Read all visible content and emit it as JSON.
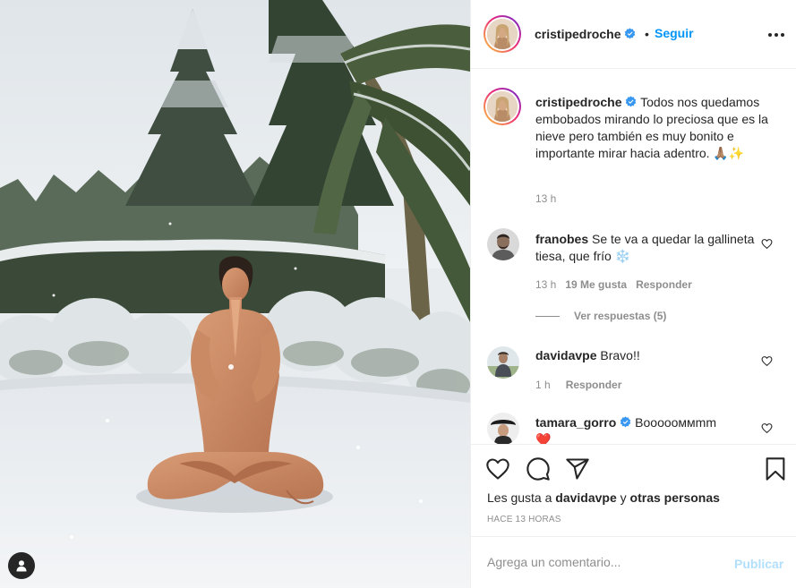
{
  "photo": {
    "alt_icon": "user-tag-icon"
  },
  "header": {
    "username": "cristipedroche",
    "verified": true,
    "separator": "•",
    "follow_label": "Seguir",
    "more_icon": "more-options-icon"
  },
  "caption": {
    "username": "cristipedroche",
    "text": "Todos nos quedamos embobados mirando lo preciosa que es la nieve pero también es muy bonito e importante mirar hacia adentro. 🙏🏽✨",
    "time": "13 h"
  },
  "comments": [
    {
      "username": "franobes",
      "text": "Se te va a quedar la gallineta tiesa, que frío ❄️",
      "time": "13 h",
      "likes": "19 Me gusta",
      "reply_label": "Responder",
      "view_replies": "Ver respuestas (5)"
    },
    {
      "username": "davidavpe",
      "text": "Bravo!!",
      "time": "1 h",
      "reply_label": "Responder"
    },
    {
      "username": "tamara_gorro",
      "verified": true,
      "text": "Boooooммmm",
      "emoji": "❤️"
    }
  ],
  "actions": {
    "like_icon": "heart-icon",
    "comment_icon": "comment-icon",
    "share_icon": "share-icon",
    "save_icon": "bookmark-icon",
    "likes_prefix": "Les gusta a",
    "likes_user": "davidavpe",
    "likes_conj": "y",
    "likes_others": "otras personas",
    "posted": "HACE 13 HORAS"
  },
  "add_comment": {
    "placeholder": "Agrega un comentario...",
    "publish_label": "Publicar"
  },
  "colors": {
    "link_blue": "#0095f6",
    "publish_disabled": "#b2dffc",
    "text": "#262626",
    "muted": "#8e8e8e"
  }
}
